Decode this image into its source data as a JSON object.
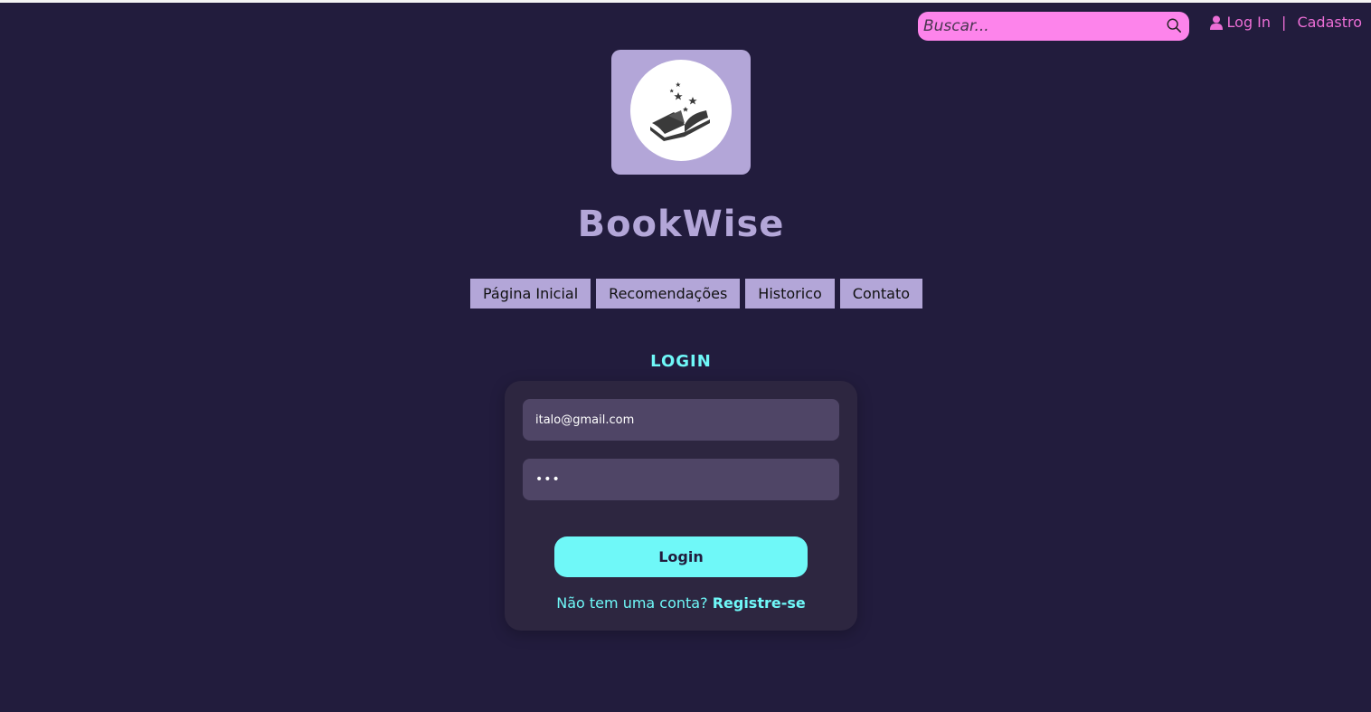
{
  "header": {
    "search_placeholder": "Buscar...",
    "search_value": "",
    "login_link": "Log In",
    "separator": "|",
    "signup_link": "Cadastro"
  },
  "brand": {
    "name": "BookWise",
    "logo_icon": "book-stars-icon"
  },
  "nav": {
    "items": [
      {
        "label": "Página Inicial"
      },
      {
        "label": "Recomendações"
      },
      {
        "label": "Historico"
      },
      {
        "label": "Contato"
      }
    ]
  },
  "login": {
    "title": "LOGIN",
    "email_value": "italo@gmail.com",
    "password_value": "•••",
    "button_label": "Login",
    "no_account_text": "Não tem uma conta?",
    "register_link": "Registre-se"
  },
  "colors": {
    "background": "#221c3d",
    "accent_pink": "#fd84eb",
    "accent_cyan": "#6ff8f8",
    "lavender": "#b3a6d8"
  }
}
